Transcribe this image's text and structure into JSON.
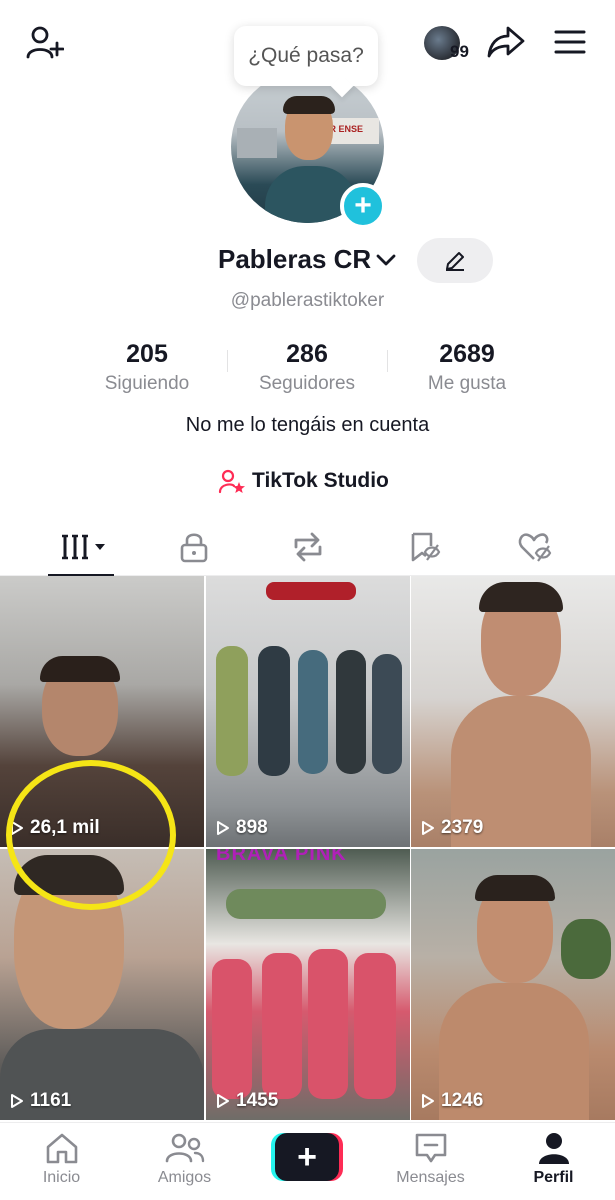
{
  "header": {
    "add_friend_icon": "person-add-icon",
    "notification_count": "99",
    "share_icon": "share-arrow-icon",
    "menu_icon": "hamburger-menu-icon"
  },
  "profile": {
    "status_bubble": "¿Qué pasa?",
    "display_name": "Pableras CR",
    "username": "@pablerastiktoker",
    "bio": "No me lo tengáis en cuenta",
    "studio_label": "TikTok Studio",
    "avatar_sign_text": "AR ENSE"
  },
  "stats": [
    {
      "value": "205",
      "label": "Siguiendo"
    },
    {
      "value": "286",
      "label": "Seguidores"
    },
    {
      "value": "2689",
      "label": "Me gusta"
    }
  ],
  "tabs": [
    {
      "icon": "videos-grid-icon",
      "active": true
    },
    {
      "icon": "lock-icon",
      "active": false
    },
    {
      "icon": "repost-icon",
      "active": false
    },
    {
      "icon": "bookmark-icon",
      "active": false
    },
    {
      "icon": "liked-heart-icon",
      "active": false
    }
  ],
  "videos": [
    {
      "views": "26,1 mil",
      "overlay_text": ""
    },
    {
      "views": "898",
      "overlay_text": ""
    },
    {
      "views": "2379",
      "overlay_text": ""
    },
    {
      "views": "1161",
      "overlay_text": ""
    },
    {
      "views": "1455",
      "overlay_text": "BRAVA PINK"
    },
    {
      "views": "1246",
      "overlay_text": ""
    }
  ],
  "bottom_nav": [
    {
      "label": "Inicio",
      "icon": "home-icon",
      "active": false
    },
    {
      "label": "Amigos",
      "icon": "friends-icon",
      "active": false
    },
    {
      "label": "",
      "icon": "create-plus-icon",
      "active": false
    },
    {
      "label": "Mensajes",
      "icon": "inbox-icon",
      "active": false
    },
    {
      "label": "Perfil",
      "icon": "profile-icon",
      "active": true
    }
  ],
  "colors": {
    "accent_cyan": "#25f4ee",
    "accent_red": "#fe2c55",
    "avatar_add": "#20c1dc",
    "highlight": "#f5e516"
  }
}
